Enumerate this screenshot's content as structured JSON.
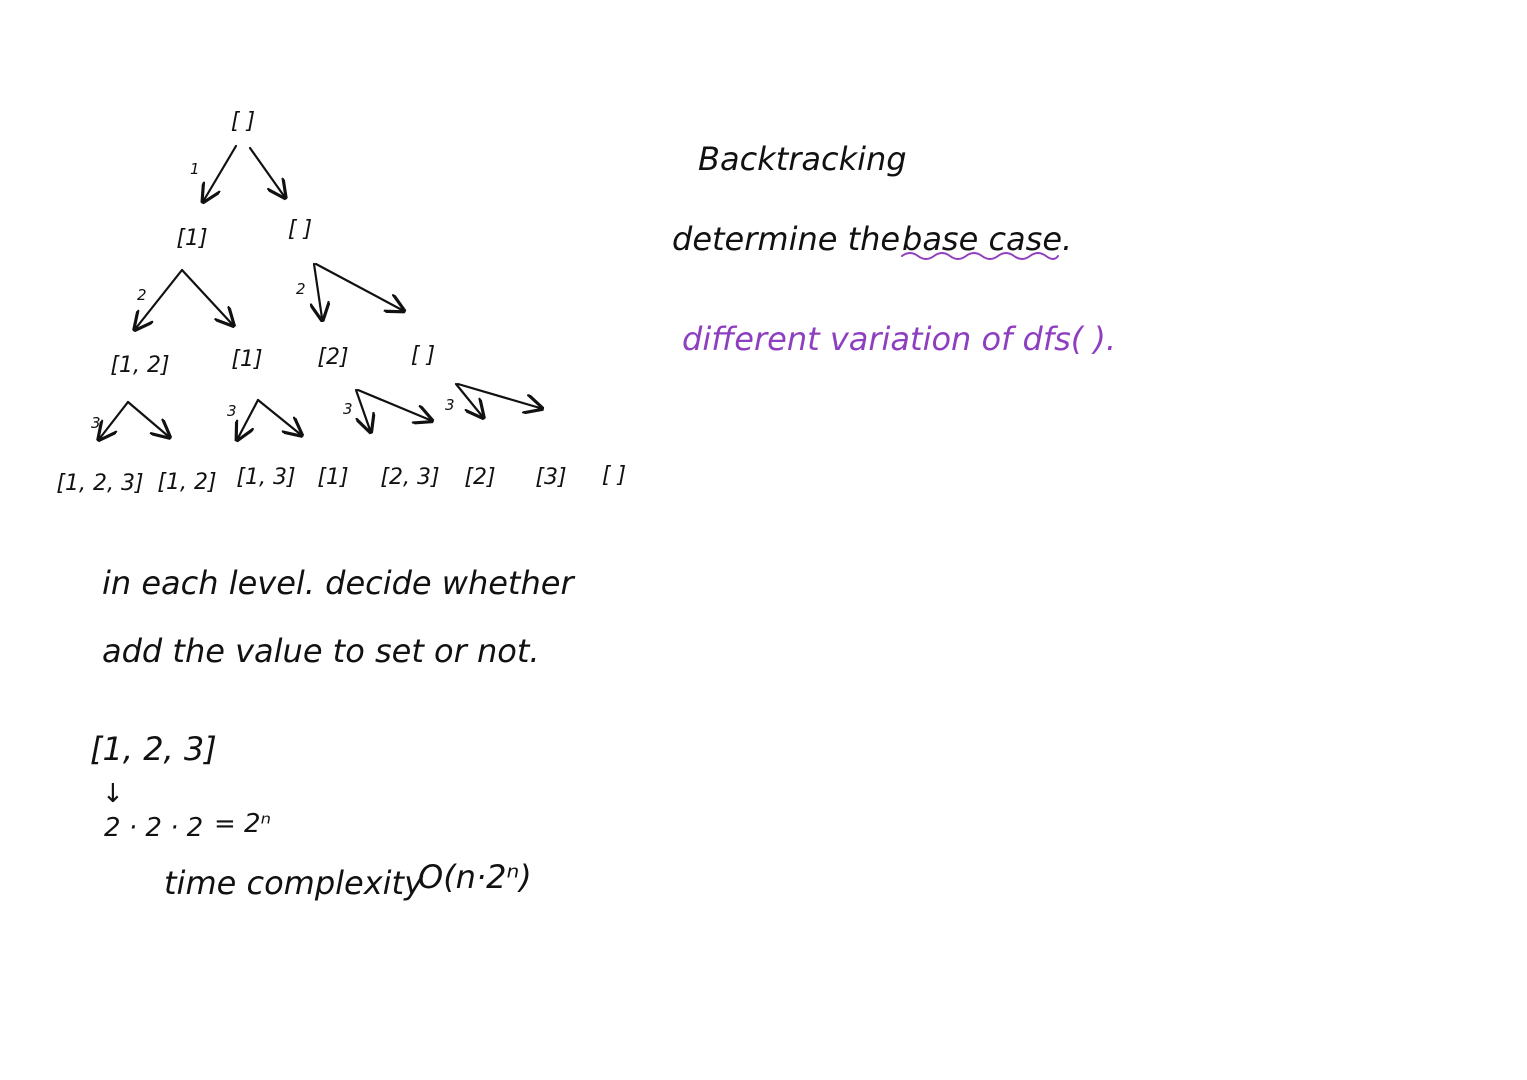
{
  "tree": {
    "root": "[ ]",
    "level1": [
      "[1]",
      "[ ]"
    ],
    "level2": [
      "[1, 2]",
      "[1]",
      "[2]",
      "[ ]"
    ],
    "level3": [
      "[1, 2, 3]",
      "[1, 2]",
      "[1, 3]",
      "[1]",
      "[2, 3]",
      "[2]",
      "[3]",
      "[ ]"
    ],
    "edge_labels": {
      "level1": "1",
      "level2": [
        "2",
        "2"
      ],
      "level3": [
        "3",
        "3",
        "3",
        "3"
      ]
    }
  },
  "notes": {
    "title": "Backtracking",
    "base_case_prefix": "determine the",
    "base_case": "base case.",
    "variation": "different variation of dfs( ).",
    "level_line1": "in each level. decide whether",
    "level_line2": "add the value to set or not.",
    "example_set": "[1, 2, 3]",
    "down_arrow": "↓",
    "product": "2 · 2 · 2",
    "product_eq": "= 2ⁿ",
    "complexity_label": "time complexity",
    "complexity_value": "O(n·2ⁿ)"
  },
  "colors": {
    "ink": "#111111",
    "accent": "#8e3fc0"
  }
}
